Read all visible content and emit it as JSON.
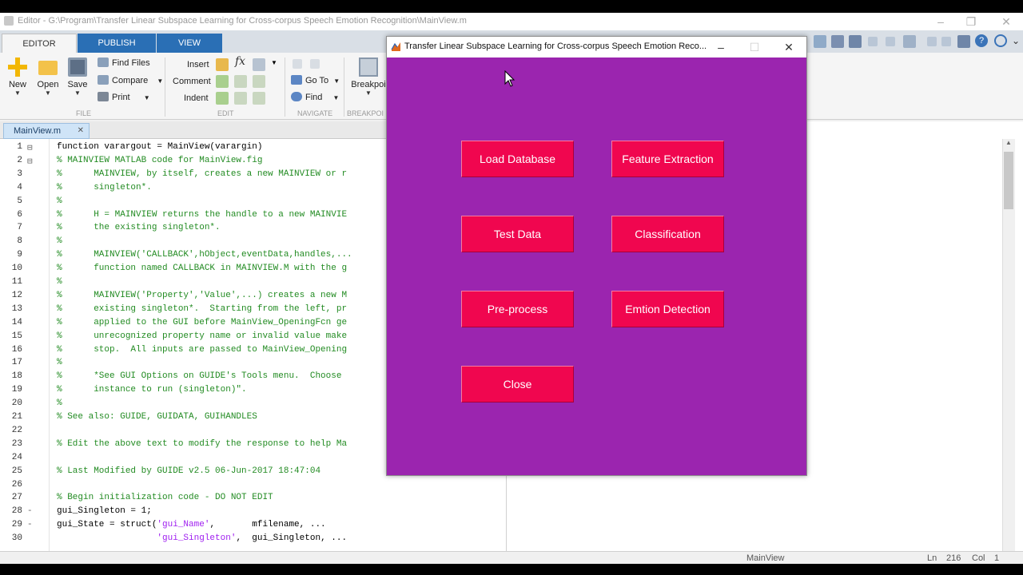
{
  "matlab": {
    "window_title": "Editor - G:\\Program\\Transfer Linear Subspace Learning for Cross-corpus Speech Emotion Recognition\\MainView.m",
    "tabs": [
      "EDITOR",
      "PUBLISH",
      "VIEW"
    ],
    "ribbon": {
      "new": "New",
      "open": "Open",
      "save": "Save",
      "find_files": "Find Files",
      "compare": "Compare",
      "print": "Print",
      "insert": "Insert",
      "comment": "Comment",
      "indent": "Indent",
      "goto": "Go To",
      "find": "Find",
      "breakpoints": "Breakpoi",
      "groups": {
        "file": "FILE",
        "edit": "EDIT",
        "navigate": "NAVIGATE",
        "breakpoints": "BREAKPOI"
      }
    },
    "file_tab": "MainView.m",
    "status": {
      "function": "MainView",
      "ln_label": "Ln",
      "ln": "216",
      "col_label": "Col",
      "col": "1"
    }
  },
  "code_lines": [
    {
      "n": "1",
      "fold": "⊟",
      "t": "function varargout = MainView(varargin)",
      "cls": ""
    },
    {
      "n": "2",
      "fold": "⊟",
      "t": "% MAINVIEW MATLAB code for MainView.fig",
      "cls": "c"
    },
    {
      "n": "3",
      "fold": "",
      "t": "%      MAINVIEW, by itself, creates a new MAINVIEW or r",
      "cls": "c"
    },
    {
      "n": "4",
      "fold": "",
      "t": "%      singleton*.",
      "cls": "c"
    },
    {
      "n": "5",
      "fold": "",
      "t": "%",
      "cls": "c"
    },
    {
      "n": "6",
      "fold": "",
      "t": "%      H = MAINVIEW returns the handle to a new MAINVIE",
      "cls": "c"
    },
    {
      "n": "7",
      "fold": "",
      "t": "%      the existing singleton*.",
      "cls": "c"
    },
    {
      "n": "8",
      "fold": "",
      "t": "%",
      "cls": "c"
    },
    {
      "n": "9",
      "fold": "",
      "t": "%      MAINVIEW('CALLBACK',hObject,eventData,handles,...",
      "cls": "c"
    },
    {
      "n": "10",
      "fold": "",
      "t": "%      function named CALLBACK in MAINVIEW.M with the g",
      "cls": "c"
    },
    {
      "n": "11",
      "fold": "",
      "t": "%",
      "cls": "c"
    },
    {
      "n": "12",
      "fold": "",
      "t": "%      MAINVIEW('Property','Value',...) creates a new M",
      "cls": "c"
    },
    {
      "n": "13",
      "fold": "",
      "t": "%      existing singleton*.  Starting from the left, pr",
      "cls": "c"
    },
    {
      "n": "14",
      "fold": "",
      "t": "%      applied to the GUI before MainView_OpeningFcn ge",
      "cls": "c"
    },
    {
      "n": "15",
      "fold": "",
      "t": "%      unrecognized property name or invalid value make",
      "cls": "c"
    },
    {
      "n": "16",
      "fold": "",
      "t": "%      stop.  All inputs are passed to MainView_Opening",
      "cls": "c"
    },
    {
      "n": "17",
      "fold": "",
      "t": "%",
      "cls": "c"
    },
    {
      "n": "18",
      "fold": "",
      "t": "%      *See GUI Options on GUIDE's Tools menu.  Choose",
      "cls": "c"
    },
    {
      "n": "19",
      "fold": "",
      "t": "%      instance to run (singleton)\".",
      "cls": "c"
    },
    {
      "n": "20",
      "fold": "",
      "t": "%",
      "cls": "c"
    },
    {
      "n": "21",
      "fold": "",
      "t": "% See also: GUIDE, GUIDATA, GUIHANDLES",
      "cls": "c"
    },
    {
      "n": "22",
      "fold": "",
      "t": "",
      "cls": ""
    },
    {
      "n": "23",
      "fold": "",
      "t": "% Edit the above text to modify the response to help Ma",
      "cls": "c"
    },
    {
      "n": "24",
      "fold": "",
      "t": "",
      "cls": ""
    },
    {
      "n": "25",
      "fold": "",
      "t": "% Last Modified by GUIDE v2.5 06-Jun-2017 18:47:04",
      "cls": "c"
    },
    {
      "n": "26",
      "fold": "",
      "t": "",
      "cls": ""
    },
    {
      "n": "27",
      "fold": "",
      "t": "% Begin initialization code - DO NOT EDIT",
      "cls": "c"
    },
    {
      "n": "28",
      "fold": "-",
      "t": "gui_Singleton = 1;",
      "cls": ""
    },
    {
      "n": "29",
      "fold": "-",
      "t": "gui_State = struct('gui_Name',       mfilename, ...",
      "cls": "mix29"
    },
    {
      "n": "30",
      "fold": "",
      "t": "                   'gui_Singleton',  gui_Singleton, ...",
      "cls": "mix30"
    }
  ],
  "gui": {
    "title": "Transfer Linear Subspace Learning for Cross-corpus Speech Emotion Reco...",
    "background": "#9b25af",
    "button_color": "#f0064f",
    "buttons": {
      "load_database": "Load Database",
      "feature_extraction": "Feature Extraction",
      "test_data": "Test Data",
      "classification": "Classification",
      "preprocess": "Pre-process",
      "emotion_detection": "Emtion Detection",
      "close": "Close"
    }
  }
}
